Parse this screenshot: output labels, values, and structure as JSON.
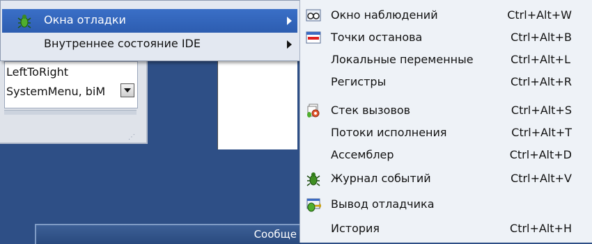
{
  "main_menu": {
    "items": [
      {
        "label": "Окна отладки",
        "icon": "bug-icon",
        "highlighted": true,
        "has_submenu": true
      },
      {
        "label": "Внутреннее состояние IDE",
        "icon": "",
        "highlighted": false,
        "has_submenu": true
      }
    ]
  },
  "submenu": {
    "items": [
      {
        "label": "Окно наблюдений",
        "shortcut": "Ctrl+Alt+W",
        "icon": "watch-glasses-icon"
      },
      {
        "label": "Точки останова",
        "shortcut": "Ctrl+Alt+B",
        "icon": "breakpoint-icon"
      },
      {
        "label": "Локальные переменные",
        "shortcut": "Ctrl+Alt+L",
        "icon": ""
      },
      {
        "label": "Регистры",
        "shortcut": "Ctrl+Alt+R",
        "icon": ""
      },
      {
        "label": "Стек вызовов",
        "shortcut": "Ctrl+Alt+S",
        "icon": "call-stack-icon"
      },
      {
        "label": "Потоки исполнения",
        "shortcut": "Ctrl+Alt+T",
        "icon": ""
      },
      {
        "label": "Ассемблер",
        "shortcut": "Ctrl+Alt+D",
        "icon": ""
      },
      {
        "label": "Журнал событий",
        "shortcut": "Ctrl+Alt+V",
        "icon": "event-log-bug-icon"
      },
      {
        "label": "Вывод отладчика",
        "shortcut": "",
        "icon": "debug-output-icon"
      },
      {
        "label": "История",
        "shortcut": "Ctrl+Alt+H",
        "icon": ""
      }
    ]
  },
  "background": {
    "property_values": [
      "LeftToRight",
      "SystemMenu, biM"
    ],
    "bottom_window_title": "Сообще"
  },
  "colors": {
    "highlight": "#2d5db0",
    "desktop": "#2e4f86",
    "menu_bg": "#e3e8f1",
    "submenu_bg": "#eef2f7"
  }
}
